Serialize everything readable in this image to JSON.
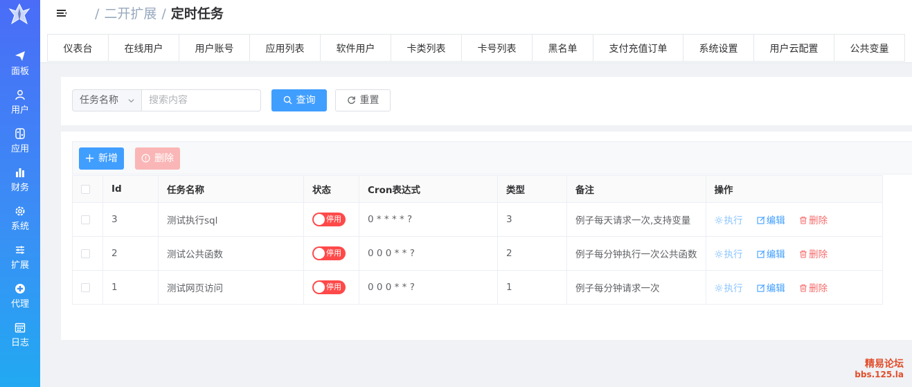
{
  "sidebar": {
    "items": [
      {
        "label": "面板",
        "icon": "paper-plane-icon"
      },
      {
        "label": "用户",
        "icon": "user-icon"
      },
      {
        "label": "应用",
        "icon": "switch-app-icon"
      },
      {
        "label": "财务",
        "icon": "bar-chart-icon"
      },
      {
        "label": "系统",
        "icon": "gear-icon"
      },
      {
        "label": "扩展",
        "icon": "sliders-icon"
      },
      {
        "label": "代理",
        "icon": "cross-circle-icon"
      },
      {
        "label": "日志",
        "icon": "calendar-icon"
      }
    ]
  },
  "header": {
    "breadcrumb": [
      "二开扩展",
      "定时任务"
    ]
  },
  "tabs": [
    "仪表台",
    "在线用户",
    "用户账号",
    "应用列表",
    "软件用户",
    "卡类列表",
    "卡号列表",
    "黑名单",
    "支付充值订单",
    "系统设置",
    "用户云配置",
    "公共变量"
  ],
  "search": {
    "select_value": "任务名称",
    "input_placeholder": "搜索内容",
    "query_label": "查询",
    "reset_label": "重置"
  },
  "toolbar": {
    "add_label": "新增",
    "delete_label": "删除"
  },
  "table": {
    "headers": [
      "Id",
      "任务名称",
      "状态",
      "Cron表达式",
      "类型",
      "备注",
      "操作"
    ],
    "rows": [
      {
        "id": "3",
        "name": "测试执行sql",
        "status": "停用",
        "cron": "0 * * * * ?",
        "type": "3",
        "remark": "例子每天请求一次,支持变量"
      },
      {
        "id": "2",
        "name": "测试公共函数",
        "status": "停用",
        "cron": "0 0 0 * * ?",
        "type": "2",
        "remark": "例子每分钟执行一次公共函数"
      },
      {
        "id": "1",
        "name": "测试网页访问",
        "status": "停用",
        "cron": "0 0 0 * * ?",
        "type": "1",
        "remark": "例子每分钟请求一次"
      }
    ],
    "actions": {
      "run": "执行",
      "edit": "编辑",
      "delete": "删除"
    }
  },
  "watermark": {
    "line1": "精易论坛",
    "line2": "bbs.125.la"
  },
  "colors": {
    "primary": "#409eff",
    "danger": "#f56c6c",
    "switch_off": "#ff4949",
    "sidebar_top": "#4a6cf7",
    "sidebar_bottom": "#22a9f2"
  }
}
